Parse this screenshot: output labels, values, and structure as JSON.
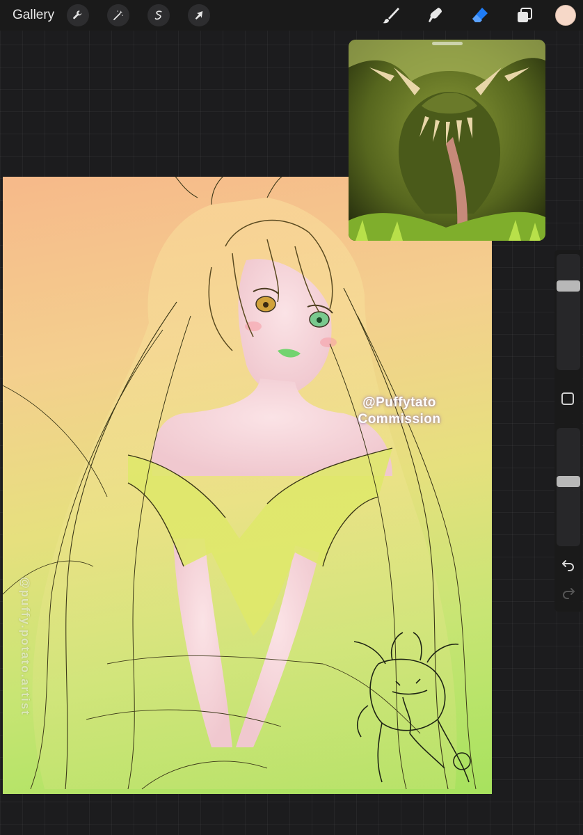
{
  "toolbar": {
    "gallery_label": "Gallery",
    "left_tools": [
      {
        "icon": "wrench-icon",
        "name": "actions"
      },
      {
        "icon": "magic-wand-icon",
        "name": "adjustments"
      },
      {
        "icon": "selection-icon",
        "name": "selection"
      },
      {
        "icon": "arrow-cursor-icon",
        "name": "transform"
      }
    ],
    "right_tools": [
      {
        "icon": "brush-icon",
        "name": "brush"
      },
      {
        "icon": "smudge-icon",
        "name": "smudge"
      },
      {
        "icon": "eraser-icon",
        "name": "eraser",
        "active": true
      },
      {
        "icon": "layers-icon",
        "name": "layers"
      }
    ],
    "active_color": "#f6d8c8",
    "accent_color": "#1f7cf5"
  },
  "canvas": {
    "watermark_center_line1": "@Puffytato",
    "watermark_center_line2": "Commission",
    "watermark_vertical": "@puffy.potato.artist"
  },
  "sidebar": {
    "brush_size_level": 0.75,
    "opacity_level": 0.55
  }
}
